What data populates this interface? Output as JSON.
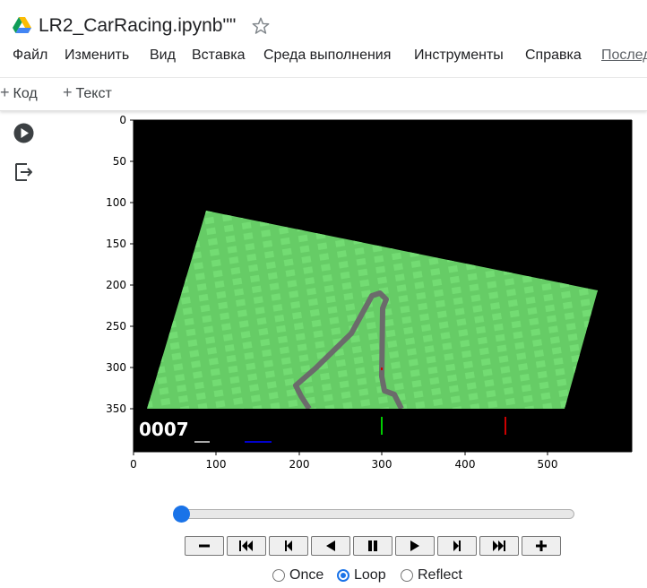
{
  "notebook": {
    "title": "LR2_CarRacing.ipynb\"\""
  },
  "menu": [
    "Файл",
    "Изменить",
    "Вид",
    "Вставка",
    "Среда выполнения",
    "Инструменты",
    "Справка",
    "Последн"
  ],
  "toolbar": {
    "code_label": "Код",
    "text_label": "Текст"
  },
  "plot": {
    "hud_counter": "0007",
    "xticks": [
      "0",
      "100",
      "200",
      "300",
      "400",
      "500"
    ],
    "yticks": [
      "0",
      "50",
      "100",
      "150",
      "200",
      "250",
      "300",
      "350"
    ],
    "colors": {
      "background": "#000000",
      "grass": "#66cc66",
      "grass_tile": "#73dc73",
      "road": "#6b6b6b",
      "speed_bar": "#00cc00",
      "abs_bar": "#cc0000",
      "steer_bar": "#0000cc"
    }
  },
  "player": {
    "progress": 0.0,
    "buttons": [
      "decrease-speed",
      "first-frame",
      "previous-frame",
      "play-reverse",
      "pause",
      "play",
      "next-frame",
      "last-frame",
      "increase-speed"
    ],
    "loop_options": [
      "Once",
      "Loop",
      "Reflect"
    ],
    "loop_selected": "Loop"
  }
}
